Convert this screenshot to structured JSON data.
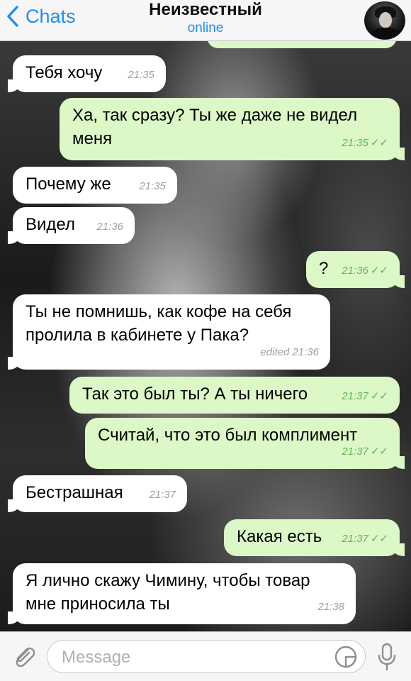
{
  "header": {
    "back_label": "Chats",
    "title": "Неизвестный",
    "status": "online",
    "accent_color": "#1f8ef1"
  },
  "messages": [
    {
      "direction": "in",
      "text": "Тебя хочу",
      "time": "21:35"
    },
    {
      "direction": "out",
      "text": "Ха, так сразу? Ты же даже не видел меня",
      "time": "21:35",
      "status_icon": "double-check-icon"
    },
    {
      "direction": "in",
      "text": "Почему же",
      "time": "21:35"
    },
    {
      "direction": "in",
      "text": "Видел",
      "time": "21:36"
    },
    {
      "direction": "out",
      "text": "?",
      "time": "21:36",
      "status_icon": "double-check-icon"
    },
    {
      "direction": "in",
      "text": "Ты не помнишь, как кофе на себя пролила в кабинете у Пака?",
      "time": "edited 21:36"
    },
    {
      "direction": "out",
      "text": "Так это был ты? А ты ничего",
      "time": "21:37",
      "status_icon": "double-check-icon"
    },
    {
      "direction": "out",
      "text": "Считай, что это был комплимент",
      "time": "21:37",
      "status_icon": "double-check-icon"
    },
    {
      "direction": "in",
      "text": "Бестрашная",
      "time": "21:37"
    },
    {
      "direction": "out",
      "text": "Какая есть",
      "time": "21:37",
      "status_icon": "double-check-icon"
    },
    {
      "direction": "in",
      "text": "Я лично скажу Чимину, чтобы товар мне приносила ты",
      "time": "21:38"
    }
  ],
  "composer": {
    "placeholder": "Message",
    "attach_icon": "paperclip-icon",
    "sticker_icon": "sticker-icon",
    "mic_icon": "microphone-icon"
  },
  "colors": {
    "incoming_bubble": "#ffffff",
    "outgoing_bubble": "#dcf8c6",
    "read_check": "#5fb65a"
  }
}
